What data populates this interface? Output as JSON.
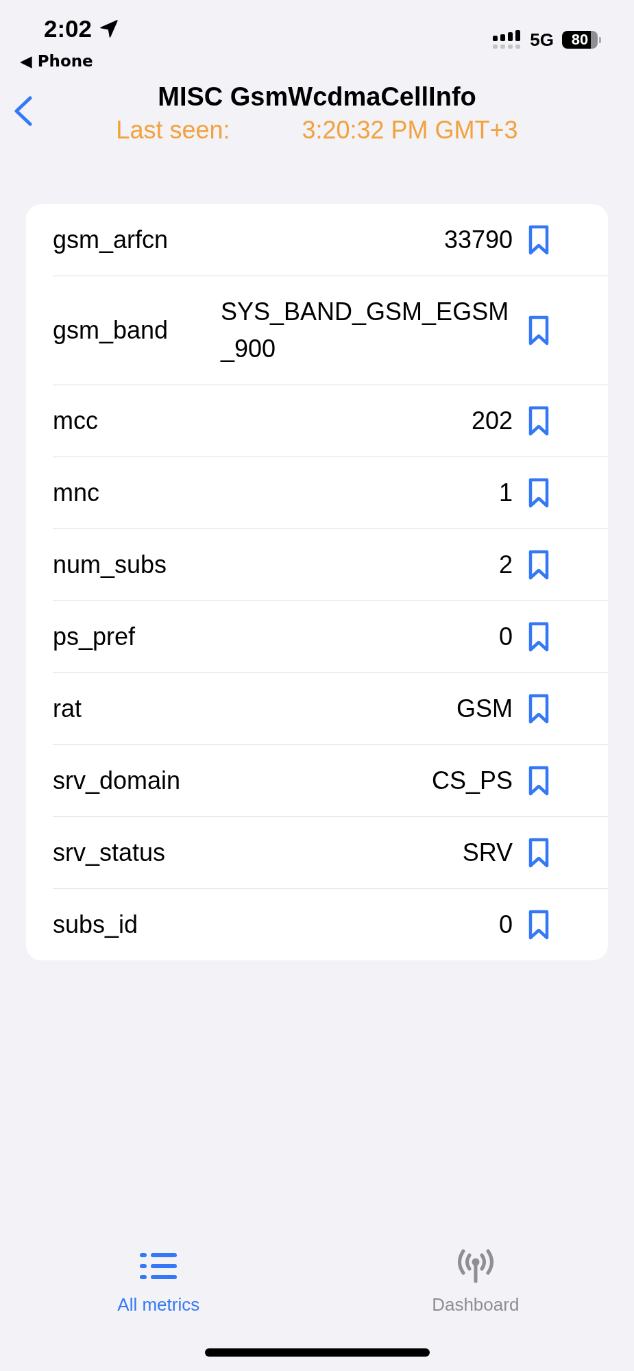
{
  "status_bar": {
    "time": "2:02",
    "return_link": "◀ Phone",
    "network": "5G",
    "battery": "80"
  },
  "header": {
    "title": "MISC GsmWcdmaCellInfo",
    "last_seen_label": "Last seen:",
    "last_seen_value": "3:20:32 PM GMT+3"
  },
  "metrics": [
    {
      "name": "gsm_arfcn",
      "value": "33790",
      "bookmarked": false
    },
    {
      "name": "gsm_band",
      "value": "SYS_BAND_GSM_EGSM_900",
      "bookmarked": false
    },
    {
      "name": "mcc",
      "value": "202",
      "bookmarked": false
    },
    {
      "name": "mnc",
      "value": "1",
      "bookmarked": false
    },
    {
      "name": "num_subs",
      "value": "2",
      "bookmarked": false
    },
    {
      "name": "ps_pref",
      "value": "0",
      "bookmarked": false
    },
    {
      "name": "rat",
      "value": "GSM",
      "bookmarked": false
    },
    {
      "name": "srv_domain",
      "value": "CS_PS",
      "bookmarked": false
    },
    {
      "name": "srv_status",
      "value": "SRV",
      "bookmarked": false
    },
    {
      "name": "subs_id",
      "value": "0",
      "bookmarked": false
    }
  ],
  "tab_bar": {
    "tabs": [
      {
        "label": "All metrics",
        "kind": "list",
        "selected": true
      },
      {
        "label": "Dashboard",
        "kind": "antenna",
        "selected": false
      }
    ]
  }
}
